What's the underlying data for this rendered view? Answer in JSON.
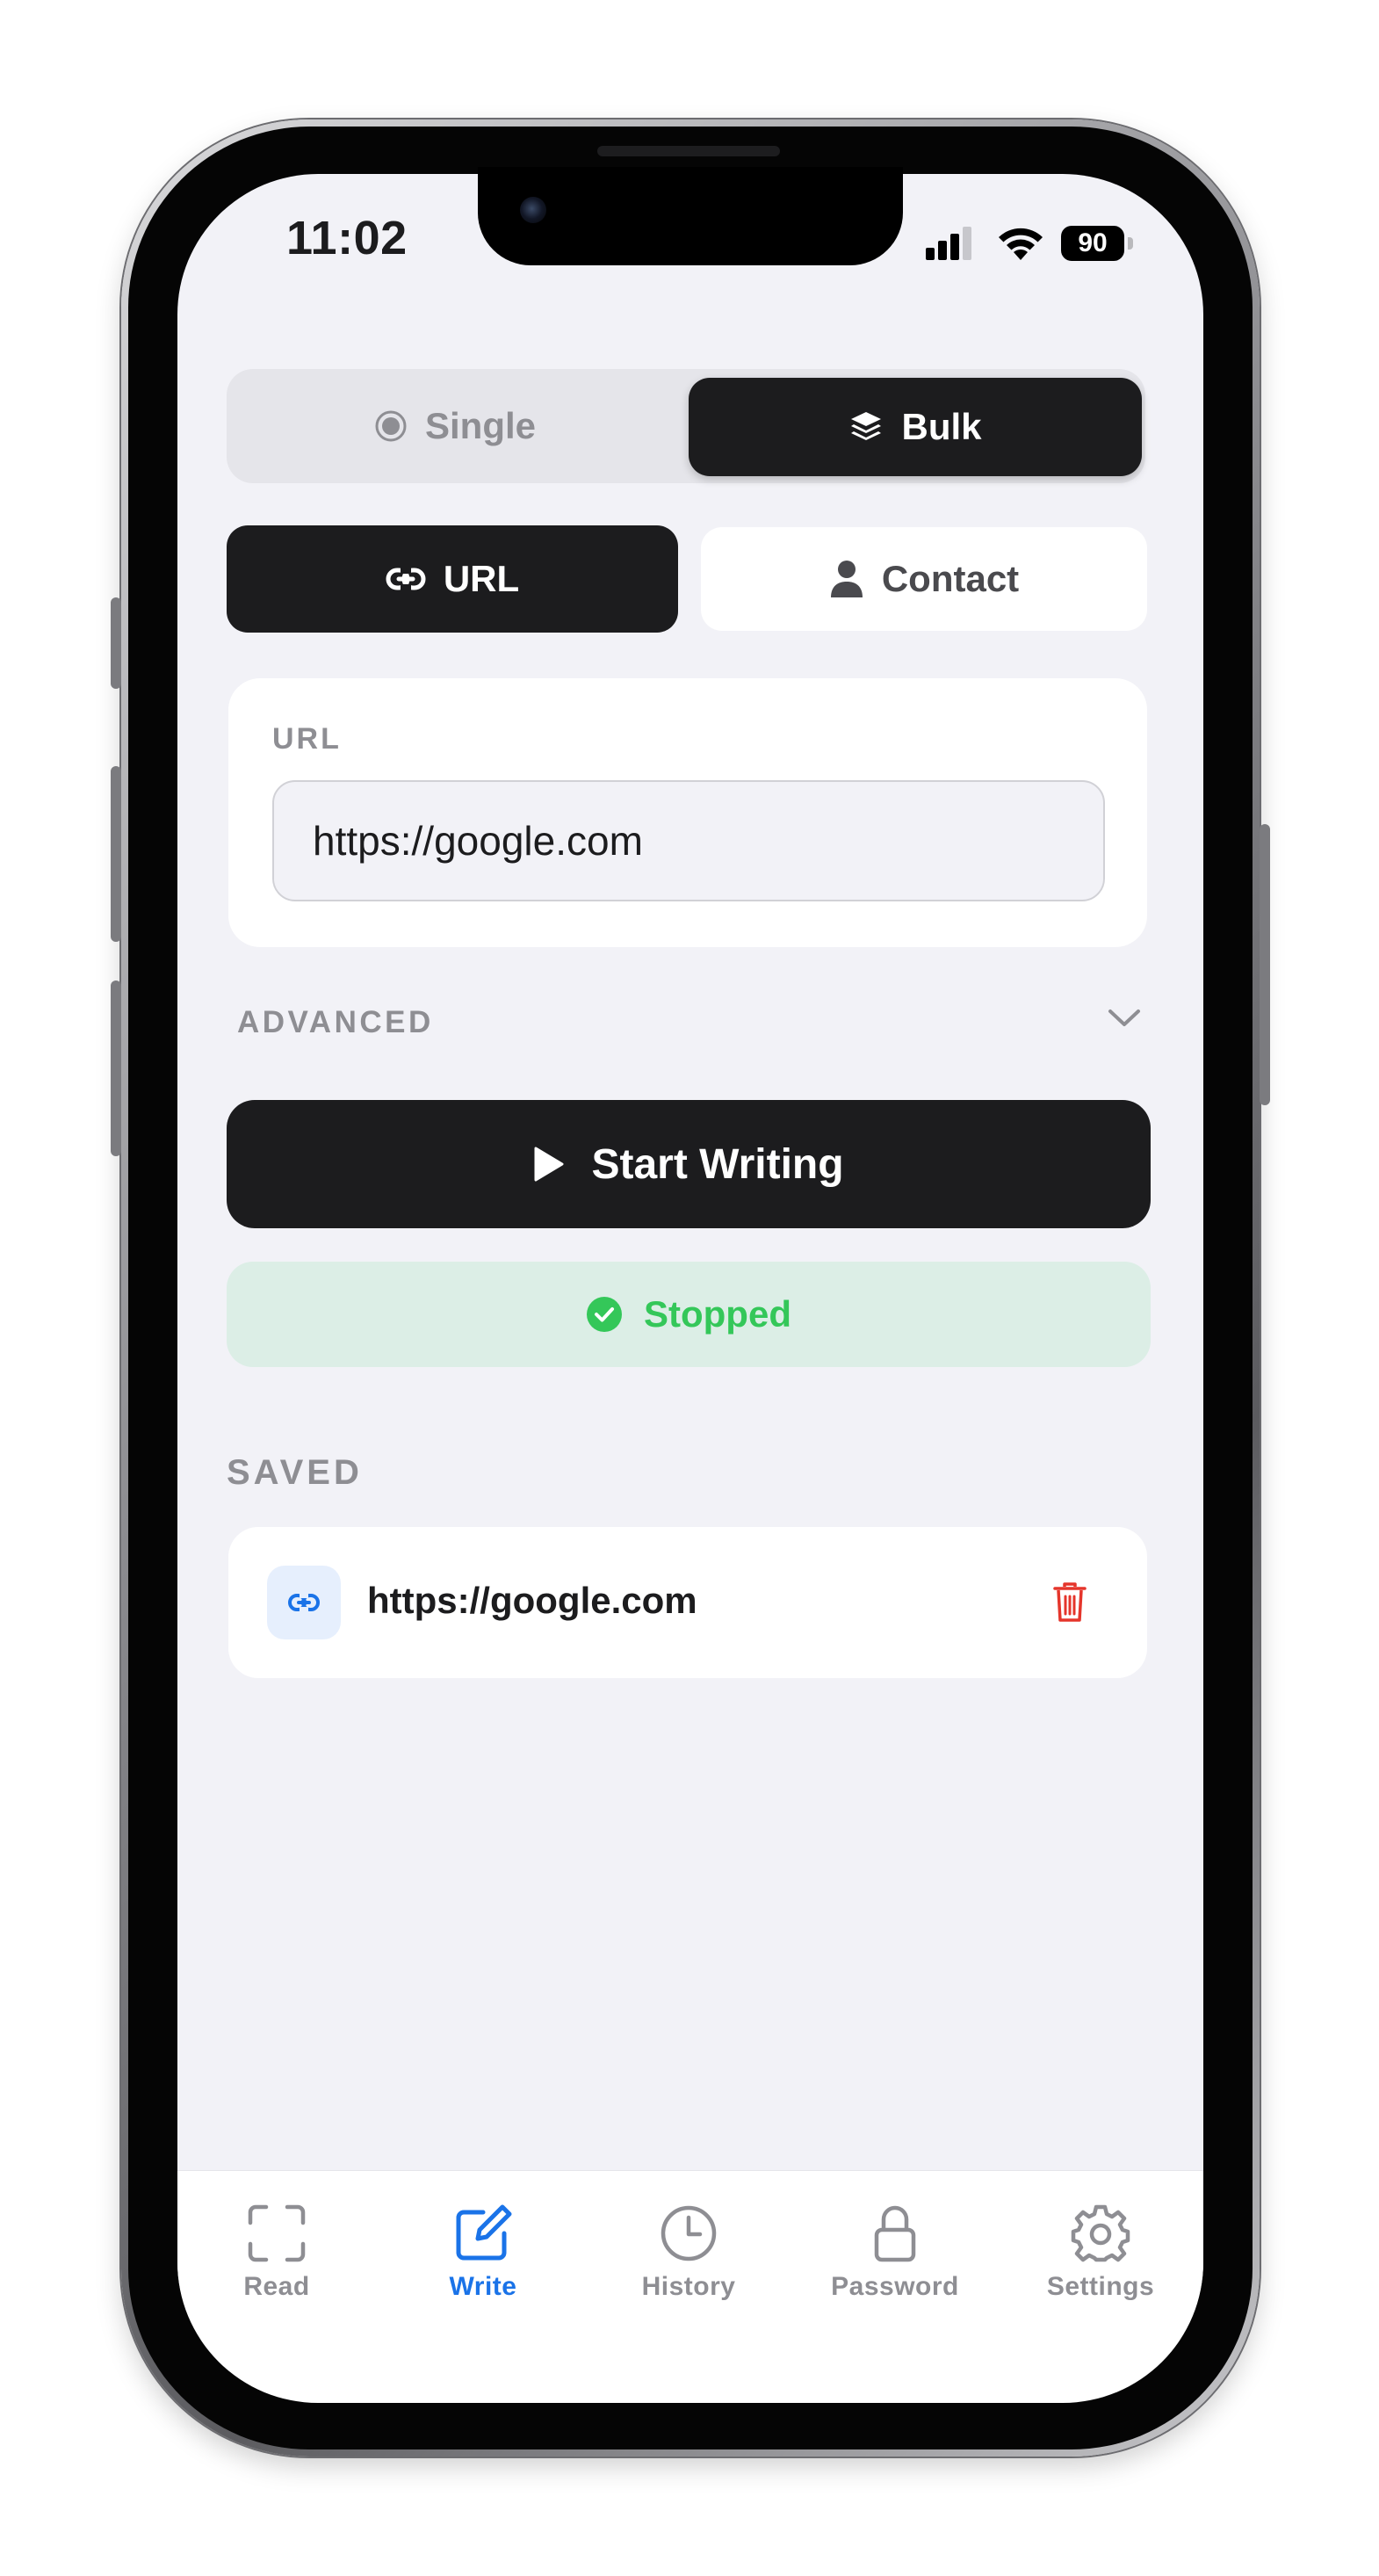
{
  "status_bar": {
    "time": "11:02",
    "battery": "90"
  },
  "mode_toggle": {
    "single_label": "Single",
    "bulk_label": "Bulk",
    "selected": "Bulk"
  },
  "record_type": {
    "url_label": "URL",
    "contact_label": "Contact",
    "selected": "URL"
  },
  "url_section": {
    "label": "URL",
    "value": "https://google.com"
  },
  "advanced": {
    "label": "ADVANCED"
  },
  "actions": {
    "start_label": "Start Writing"
  },
  "status": {
    "text": "Stopped"
  },
  "saved": {
    "heading": "SAVED",
    "items": [
      {
        "url": "https://google.com"
      }
    ]
  },
  "tabs": [
    {
      "label": "Read"
    },
    {
      "label": "Write"
    },
    {
      "label": "History"
    },
    {
      "label": "Password"
    },
    {
      "label": "Settings"
    }
  ],
  "active_tab": "Write",
  "colors": {
    "accent_blue": "#1a73e8",
    "dark_button": "#1c1c1e",
    "success_green": "#34c759",
    "success_bg": "#dceee6",
    "danger_red": "#e5352b",
    "screen_bg": "#f2f2f7"
  }
}
